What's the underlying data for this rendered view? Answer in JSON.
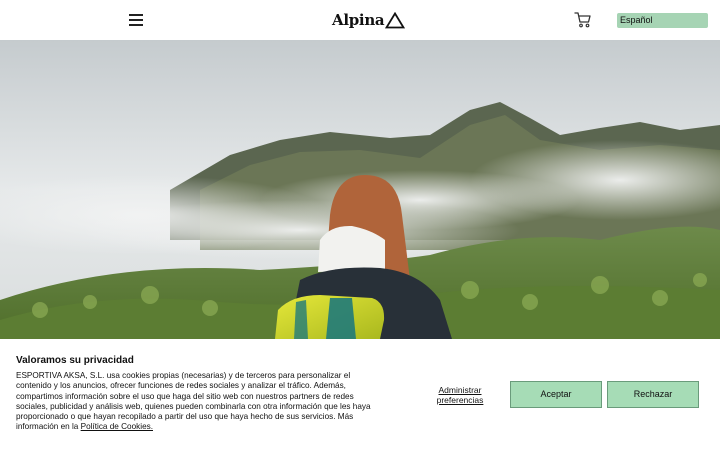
{
  "header": {
    "logo_text": "Alpina",
    "language": "Español",
    "icons": [
      "hamburger-menu-icon",
      "logo-triangle-icon",
      "shopping-cart-icon"
    ]
  },
  "hero": {
    "image": "hiker-with-yellow-backpack-misty-mountains"
  },
  "cookie": {
    "title": "Valoramos su privacidad",
    "text": "ESPORTIVA AKSA, S.L. usa cookies propias (necesarias) y de terceros para personalizar el contenido y los anuncios, ofrecer funciones de redes sociales y analizar el tráfico. Además, compartimos información sobre el uso que haga del sitio web con nuestros partners de redes sociales, publicidad y análisis web, quienes pueden combinarla con otra información que les haya proporcionado o que hayan recopilado a partir del uso que haya hecho de sus servicios. Más información en la ",
    "link_text": "Política de Cookies.",
    "preferences_label": "Administrar preferencias",
    "accept_label": "Aceptar",
    "reject_label": "Rechazar"
  },
  "colors": {
    "button_bg": "#a6dcb6",
    "button_border": "#6a9b7b",
    "language_bg": "#a6d4b4"
  }
}
